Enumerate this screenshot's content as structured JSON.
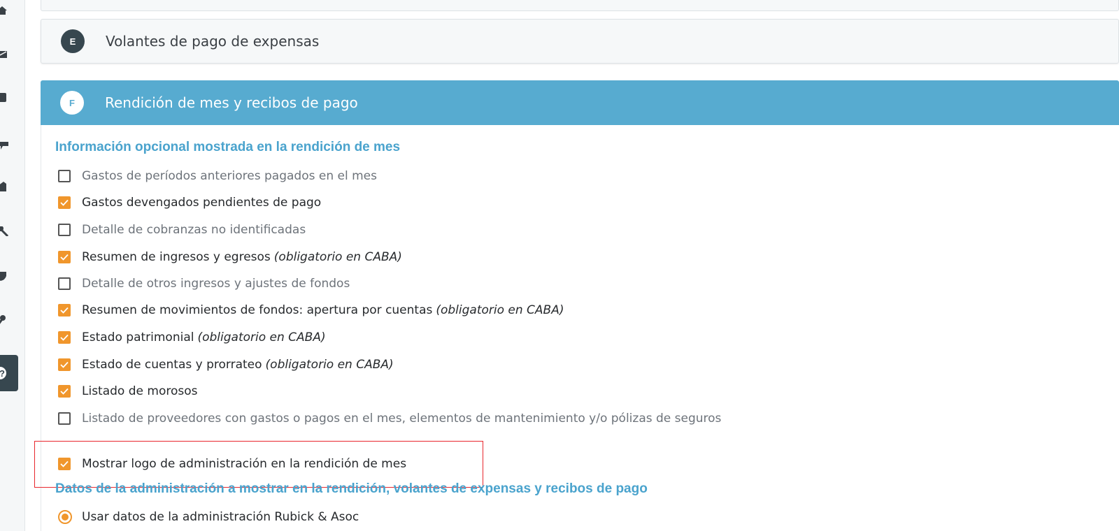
{
  "colors": {
    "accent_blue": "#57abd0",
    "section_title": "#4aa3cd",
    "checkbox_checked": "#f0962c",
    "sidebar_active": "#37474f",
    "highlight": "#e8272d"
  },
  "sidebar": {
    "icons": [
      "home-icon",
      "mail-icon",
      "book-icon",
      "comment-icon",
      "building-icon",
      "wrench-icon",
      "shield-icon",
      "tools-icon",
      "help-icon"
    ],
    "active": "help-icon"
  },
  "panels": {
    "e": {
      "badge": "E",
      "title": "Volantes de pago de expensas"
    },
    "f": {
      "badge": "F",
      "title": "Rendición de mes y recibos de pago"
    }
  },
  "section1": {
    "title": "Información opcional mostrada en la rendición de mes",
    "options": [
      {
        "label": "Gastos de períodos anteriores pagados en el mes",
        "note": "",
        "checked": false
      },
      {
        "label": "Gastos devengados pendientes de pago",
        "note": "",
        "checked": true
      },
      {
        "label": "Detalle de cobranzas no identificadas",
        "note": "",
        "checked": false
      },
      {
        "label": "Resumen de ingresos y egresos",
        "note": "(obligatorio en CABA)",
        "checked": true
      },
      {
        "label": "Detalle de otros ingresos y ajustes de fondos",
        "note": "",
        "checked": false
      },
      {
        "label": "Resumen de movimientos de fondos: apertura por cuentas",
        "note": "(obligatorio en CABA)",
        "checked": true
      },
      {
        "label": "Estado patrimonial",
        "note": "(obligatorio en CABA)",
        "checked": true
      },
      {
        "label": "Estado de cuentas y prorrateo",
        "note": "(obligatorio en CABA)",
        "checked": true
      },
      {
        "label": "Listado de morosos",
        "note": "",
        "checked": true
      },
      {
        "label": "Listado de proveedores con gastos o pagos en el mes, elementos de mantenimiento y/o pólizas de seguros",
        "note": "",
        "checked": false
      }
    ],
    "logo_option": {
      "label": "Mostrar logo de administración en la rendición de mes",
      "checked": true
    }
  },
  "section2": {
    "title": "Datos de la administración a mostrar en la rendición, volantes de expensas y recibos de pago",
    "radio_option": {
      "label": "Usar datos de la administración Rubick & Asoc",
      "selected": true
    }
  }
}
